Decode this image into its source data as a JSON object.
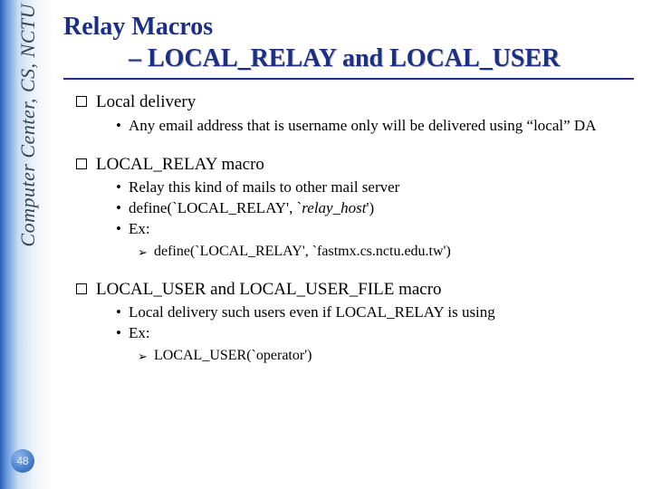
{
  "sidebar": {
    "org_text": "Computer Center, CS, NCTU"
  },
  "page_number": "48",
  "title": {
    "line1": "Relay Macros",
    "line2": "– LOCAL_RELAY and LOCAL_USER"
  },
  "sections": [
    {
      "heading": "Local delivery",
      "bullets": [
        {
          "text": "Any email address that is username only will be delivered using “local” DA"
        }
      ]
    },
    {
      "heading": "LOCAL_RELAY macro",
      "bullets": [
        {
          "text": "Relay this kind of mails to other mail server"
        },
        {
          "prefix": "define(`LOCAL_RELAY', `",
          "italic": "relay_host",
          "suffix": "')"
        },
        {
          "text": "Ex:",
          "sub": [
            {
              "text": "define(`LOCAL_RELAY', `fastmx.cs.nctu.edu.tw')"
            }
          ]
        }
      ]
    },
    {
      "heading": "LOCAL_USER and LOCAL_USER_FILE macro",
      "bullets": [
        {
          "text": "Local delivery such users even if LOCAL_RELAY is using"
        },
        {
          "text": "Ex:",
          "sub": [
            {
              "text": "LOCAL_USER(`operator')"
            }
          ]
        }
      ]
    }
  ]
}
